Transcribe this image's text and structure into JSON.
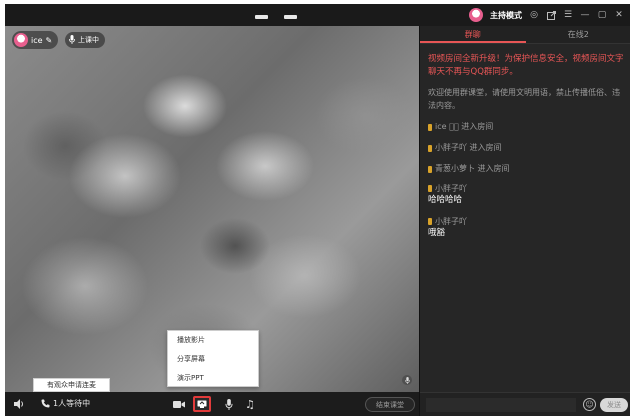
{
  "titlebar": {
    "host_mode_label": "主持模式",
    "icons": [
      "target-icon",
      "share-icon",
      "menu-icon",
      "minimize-icon",
      "maximize-icon",
      "close-icon"
    ]
  },
  "video": {
    "user_name": "ice",
    "class_status": "上课中"
  },
  "popup_menu": {
    "items": [
      "播放影片",
      "分享屏幕",
      "演示PPT"
    ]
  },
  "request_tip": "有观众申请连麦",
  "toolbar": {
    "waiting_text": "1人等待中",
    "end_class_label": "结束课堂"
  },
  "panel": {
    "tabs": [
      "群聊",
      "在线2"
    ],
    "notice": "视频房间全新升级！为保护信息安全，视频房间文字聊天不再与QQ群同步。",
    "welcome": "欢迎使用群课堂，请使用文明用语，禁止传播低俗、违法内容。",
    "system_msgs": [
      "ice ⃞⃞ 进入房间",
      "小胖子吖 进入房间",
      "青葱小萝卜 进入房间"
    ],
    "messages": [
      {
        "name": "小胖子吖",
        "text": "哈哈哈哈"
      },
      {
        "name": "小胖子吖",
        "text": "哦豁"
      }
    ],
    "send_label": "发送",
    "input_value": ""
  },
  "colors": {
    "accent": "#e85656",
    "highlight_border": "#e23b3b",
    "background": "#1e1e1e"
  }
}
